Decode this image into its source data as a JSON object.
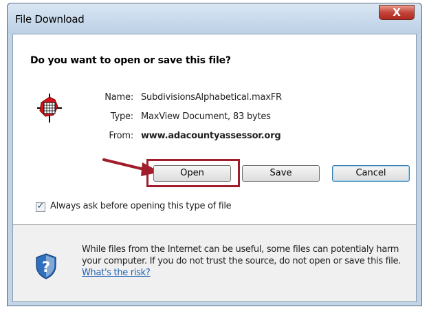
{
  "window": {
    "title": "File Download",
    "close_label": "X"
  },
  "dialog": {
    "question": "Do you want to open or save this file?",
    "file": {
      "name_label": "Name:",
      "name_value": "SubdivisionsAlphabetical.maxFR",
      "type_label": "Type:",
      "type_value": "MaxView Document, 83 bytes",
      "from_label": "From:",
      "from_value": "www.adacountyassessor.org"
    },
    "buttons": {
      "open": "Open",
      "save": "Save",
      "cancel": "Cancel"
    },
    "checkbox": {
      "label": "Always ask before opening this type of file",
      "checked": true
    }
  },
  "warning": {
    "text": "While files from the Internet can be useful, some files can potentialy harm your computer. If you do not trust the source, do not open or save this file.",
    "link": "What's the risk?"
  },
  "colors": {
    "highlight": "#a11d2b",
    "link": "#1a5fb4",
    "footer_bg": "#f0f0f0"
  },
  "icons": {
    "file": "maxview-file-icon",
    "security": "security-shield-icon",
    "annotation": "red-arrow-icon"
  }
}
